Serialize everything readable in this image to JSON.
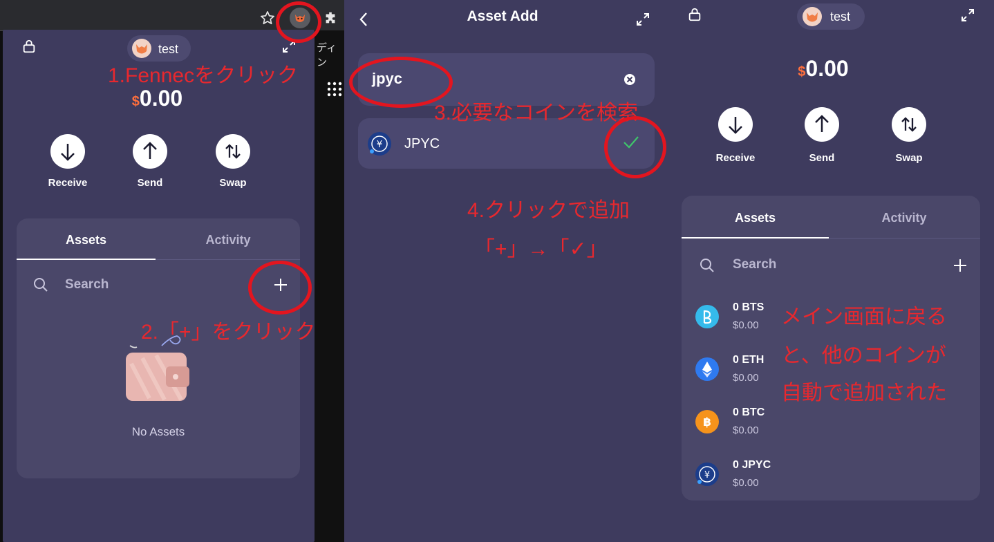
{
  "browser": {
    "tab_fragment": "ディン"
  },
  "wallet": {
    "profile_name": "test",
    "currency_symbol": "$",
    "balance": "0.00",
    "actions": {
      "receive": "Receive",
      "send": "Send",
      "swap": "Swap"
    },
    "tabs": {
      "assets": "Assets",
      "activity": "Activity"
    },
    "search_placeholder": "Search",
    "empty_label": "No Assets"
  },
  "asset_add": {
    "title": "Asset Add",
    "query": "jpyc",
    "result_label": "JPYC"
  },
  "assets_list": [
    {
      "amount": "0 BTS",
      "usd": "$0.00",
      "icon": "bitshares-icon",
      "color": "#35baeb"
    },
    {
      "amount": "0 ETH",
      "usd": "$0.00",
      "icon": "ethereum-icon",
      "color": "#2f7af0"
    },
    {
      "amount": "0 BTC",
      "usd": "$0.00",
      "icon": "bitcoin-icon",
      "color": "#f6931b"
    },
    {
      "amount": "0 JPYC",
      "usd": "$0.00",
      "icon": "jpyc-icon",
      "color": "#1c3d8a"
    }
  ],
  "annotations": {
    "step1": "1.Fennecをクリック",
    "step2": "2.「+」をクリック",
    "step3": "3.必要なコインを検索",
    "step4_line1": "4.クリックで追加",
    "step4_line2": "「+」→「✓」",
    "note_line1": "メイン画面に戻る",
    "note_line2": "と、他のコインが",
    "note_line3": "自動で追加された"
  },
  "colors": {
    "accent_red": "#e3151f",
    "bg": "#3e3b5e",
    "card": "#4a4769",
    "check": "#3fc56b",
    "dollar": "#ff6f3c"
  }
}
